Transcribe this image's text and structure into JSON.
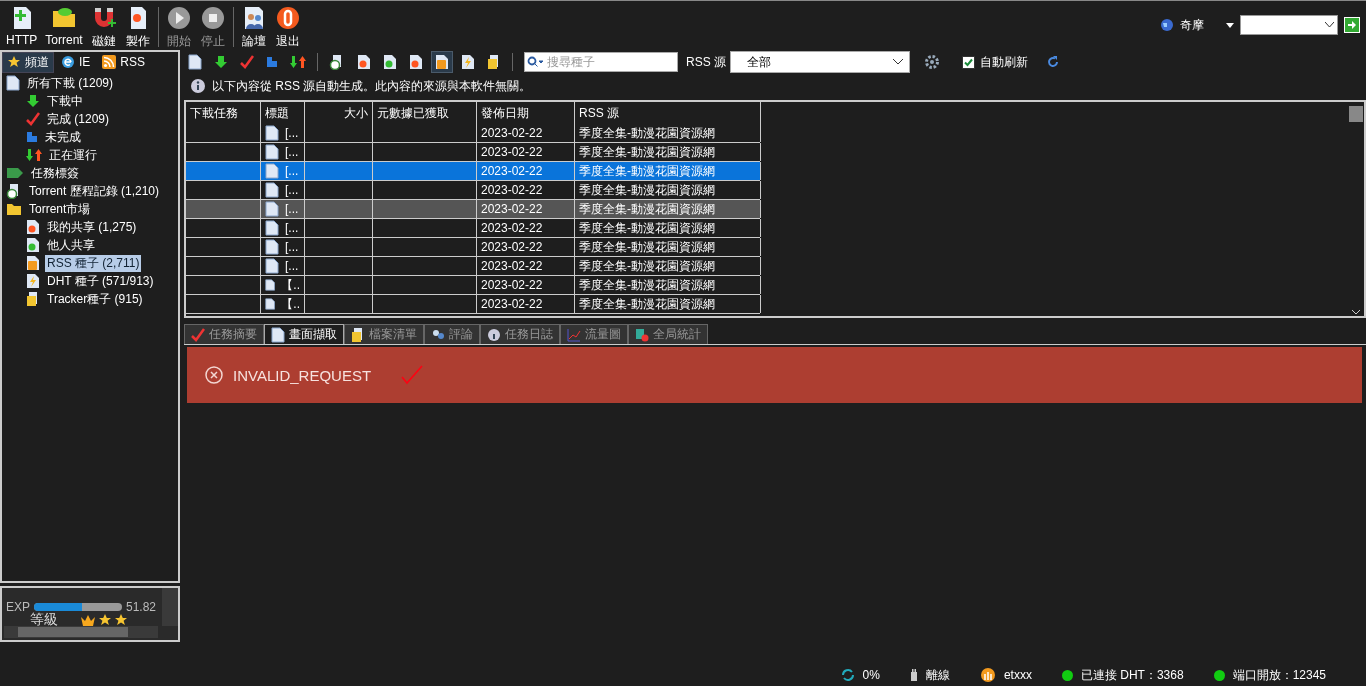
{
  "toolbar": {
    "buttons": [
      {
        "label": "HTTP",
        "disabled": false
      },
      {
        "label": "Torrent",
        "disabled": false
      },
      {
        "label": "磁鏈",
        "disabled": false
      },
      {
        "label": "製作",
        "disabled": false
      },
      {
        "label": "開始",
        "disabled": true
      },
      {
        "label": "停止",
        "disabled": true
      },
      {
        "label": "論壇",
        "disabled": false
      },
      {
        "label": "退出",
        "disabled": false
      }
    ],
    "search_engine": "奇摩"
  },
  "sidebar": {
    "tabs": [
      {
        "label": "頻道",
        "selected": true
      },
      {
        "label": "IE",
        "selected": false
      },
      {
        "label": "RSS",
        "selected": false
      }
    ],
    "tree": [
      {
        "label": "所有下載 (1209)",
        "selected": false,
        "children": [
          {
            "label": "下載中",
            "selected": false
          },
          {
            "label": "完成 (1209)",
            "selected": false
          },
          {
            "label": "未完成",
            "selected": false
          },
          {
            "label": "正在運行",
            "selected": false
          }
        ]
      },
      {
        "label": "任務標簽",
        "selected": false
      },
      {
        "label": "Torrent 歷程記錄 (1,210)",
        "selected": false
      },
      {
        "label": "Torrent市場",
        "selected": false,
        "children": [
          {
            "label": "我的共享 (1,275)",
            "selected": false
          },
          {
            "label": "他人共享",
            "selected": false
          },
          {
            "label": "RSS 種子 (2,711)",
            "selected": true
          },
          {
            "label": "DHT 種子 (571/913)",
            "selected": false
          },
          {
            "label": "Tracker種子 (915)",
            "selected": false
          }
        ]
      }
    ]
  },
  "level_panel": {
    "exp_label": "EXP",
    "level": 0.55,
    "exp_value": "51.82",
    "rank_label": "等級",
    "stars": 3
  },
  "rss_toolbar": {
    "tools": [
      {
        "selected": false
      },
      {
        "selected": false
      },
      {
        "selected": false
      },
      {
        "selected": false
      },
      {
        "selected": false
      },
      {
        "selected": false
      },
      {
        "selected": false
      },
      {
        "selected": false
      },
      {
        "selected": false
      },
      {
        "selected": true
      },
      {
        "selected": false
      },
      {
        "selected": false
      }
    ],
    "search": {
      "placeholder": "搜尋種子"
    },
    "source_label": "RSS 源",
    "source_value": "全部",
    "auto_refresh": {
      "label": "自動刷新",
      "checked": true
    }
  },
  "notice": "以下內容從 RSS 源自動生成。此內容的來源與本軟件無關。",
  "table": {
    "columns": [
      "下載任務",
      "標題",
      "大小",
      "元數據已獲取",
      "發佈日期",
      "RSS 源"
    ],
    "rows": [
      {
        "title": "[...",
        "date": "2023-02-22",
        "source": "季度全集-動漫花園資源網",
        "selected": false,
        "hovered": false
      },
      {
        "title": "[...",
        "date": "2023-02-22",
        "source": "季度全集-動漫花園資源網",
        "selected": false,
        "hovered": false
      },
      {
        "title": "[...",
        "date": "2023-02-22",
        "source": "季度全集-動漫花園資源網",
        "selected": true,
        "hovered": false
      },
      {
        "title": "[...",
        "date": "2023-02-22",
        "source": "季度全集-動漫花園資源網",
        "selected": false,
        "hovered": false
      },
      {
        "title": "[...",
        "date": "2023-02-22",
        "source": "季度全集-動漫花園資源網",
        "selected": false,
        "hovered": true
      },
      {
        "title": "[...",
        "date": "2023-02-22",
        "source": "季度全集-動漫花園資源網",
        "selected": false,
        "hovered": false
      },
      {
        "title": "[...",
        "date": "2023-02-22",
        "source": "季度全集-動漫花園資源網",
        "selected": false,
        "hovered": false
      },
      {
        "title": "[...",
        "date": "2023-02-22",
        "source": "季度全集-動漫花園資源網",
        "selected": false,
        "hovered": false
      },
      {
        "title": "【..",
        "date": "2023-02-22",
        "source": "季度全集-動漫花園資源網",
        "selected": false,
        "hovered": false
      },
      {
        "title": "【..",
        "date": "2023-02-22",
        "source": "季度全集-動漫花園資源網",
        "selected": false,
        "hovered": false
      }
    ]
  },
  "detail_tabs": [
    {
      "label": "任務摘要",
      "selected": false
    },
    {
      "label": "畫面擷取",
      "selected": true
    },
    {
      "label": "檔案清單",
      "selected": false
    },
    {
      "label": "評論",
      "selected": false
    },
    {
      "label": "任務日誌",
      "selected": false
    },
    {
      "label": "流量圖",
      "selected": false
    },
    {
      "label": "全局統計",
      "selected": false
    }
  ],
  "error": {
    "message": "INVALID_REQUEST"
  },
  "status_bar": {
    "progress": "0%",
    "connection": "離線",
    "user": "etxxx",
    "dht": "已連接 DHT：3368",
    "port": "端口開放：12345"
  }
}
